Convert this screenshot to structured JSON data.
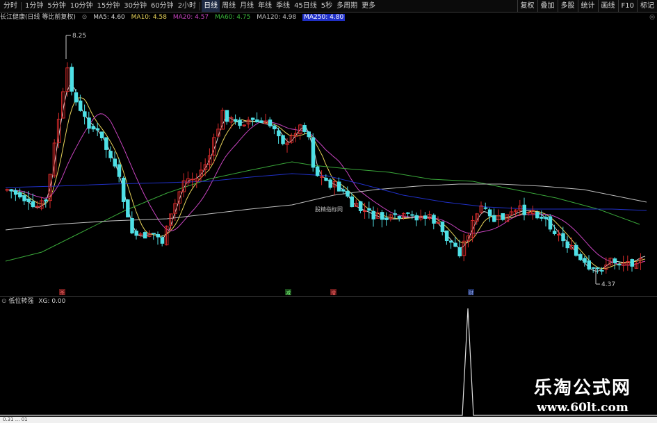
{
  "toolbar": {
    "timeframes": [
      "分时",
      "1分钟",
      "5分钟",
      "10分钟",
      "15分钟",
      "30分钟",
      "60分钟",
      "2小时",
      "日线",
      "周线",
      "月线",
      "年线",
      "季线",
      "45日线",
      "5秒",
      "多周期",
      "更多"
    ],
    "active_timeframe": "日线",
    "right_tools": [
      "复权",
      "叠加",
      "多股",
      "统计",
      "画线",
      "F10",
      "标记"
    ]
  },
  "ma_legend": {
    "stock_title": "长江健康(日线 等比前复权)",
    "ma5": "MA5: 4.60",
    "ma10": "MA10: 4.58",
    "ma20": "MA20: 4.57",
    "ma60": "MA60: 4.75",
    "ma120": "MA120: 4.98",
    "ma250": "MA250: 4.80"
  },
  "colors": {
    "up": "#d42a2a",
    "down": "#4fe0e6",
    "ma5": "#d8d8d8",
    "ma10": "#e8d45a",
    "ma20": "#c844c0",
    "ma60": "#3aa83a",
    "ma120": "#c0c0c0",
    "ma250": "#2030c8",
    "indicator": "#e0e0e0"
  },
  "main_chart": {
    "high_label": "8.25",
    "low_label": "4.37",
    "center_watermark": "股精指标网",
    "event_markers": [
      "杀",
      "减",
      "增",
      "财"
    ]
  },
  "indicator": {
    "name": "低位转强",
    "value_label": "XG: 0.00"
  },
  "watermark": {
    "cn": "乐淘公式网",
    "url": "www.60lt.com"
  },
  "bottom": {
    "text": "0.31 ... 01"
  }
}
